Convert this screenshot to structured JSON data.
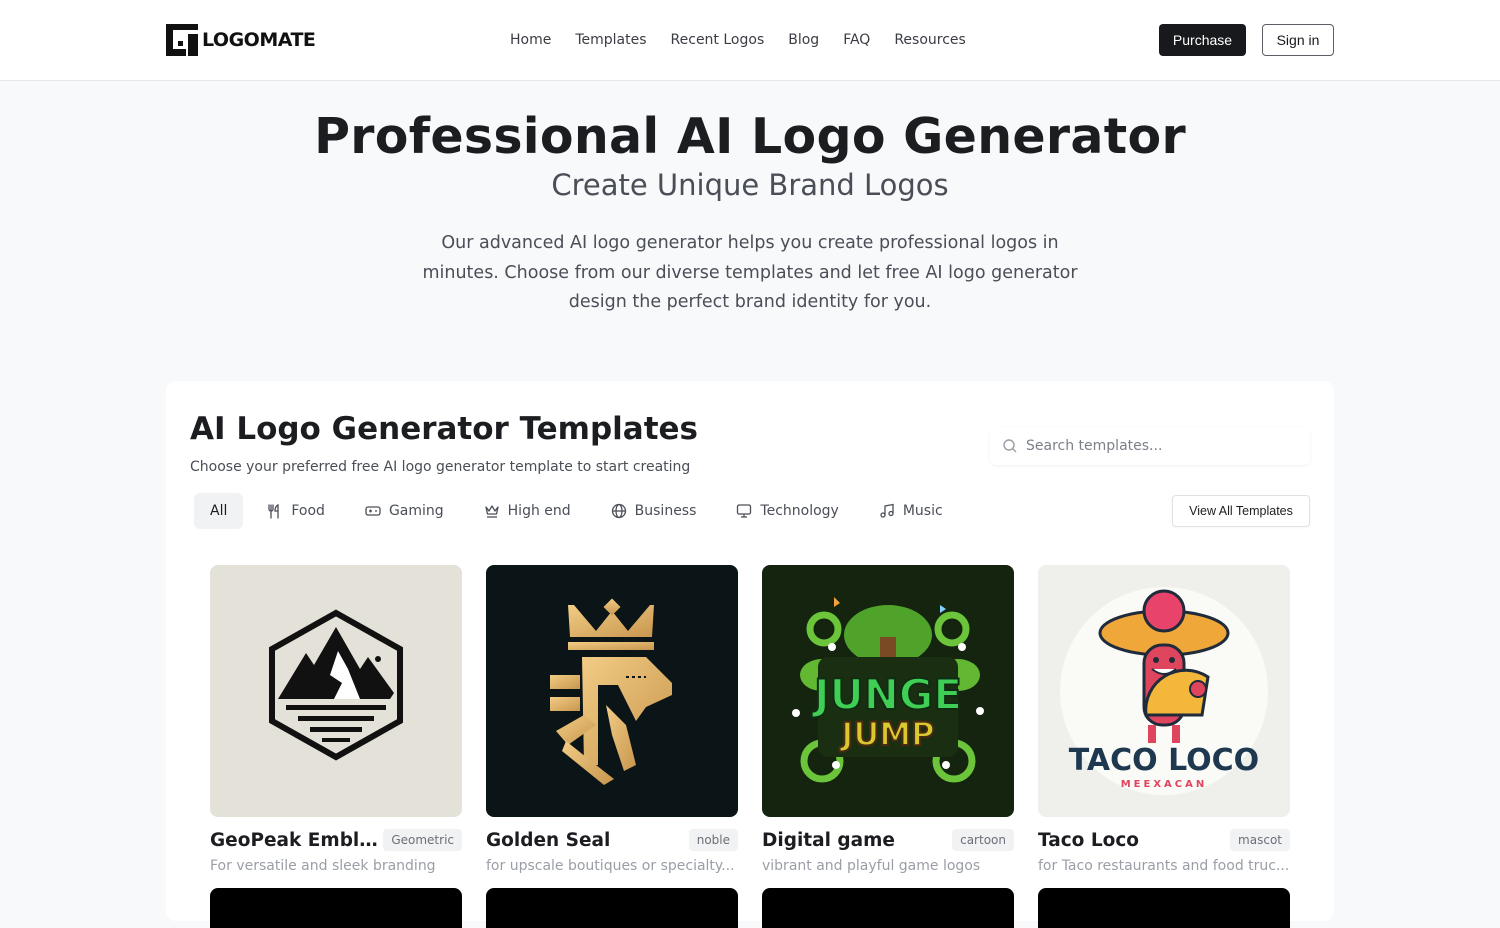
{
  "header": {
    "logo_text": "LOGOMATE",
    "nav": [
      "Home",
      "Templates",
      "Recent Logos",
      "Blog",
      "FAQ",
      "Resources"
    ],
    "purchase_label": "Purchase",
    "signin_label": "Sign in"
  },
  "hero": {
    "title": "Professional AI Logo Generator",
    "subtitle": "Create Unique Brand Logos",
    "description": "Our advanced AI logo generator helps you create professional logos in minutes. Choose from our diverse templates and let free AI logo generator design the perfect brand identity for you."
  },
  "templates": {
    "title": "AI Logo Generator Templates",
    "subtitle": "Choose your preferred free AI logo generator template to start creating",
    "search_placeholder": "Search templates...",
    "view_all_label": "View All Templates",
    "filters": [
      {
        "label": "All",
        "icon": "none",
        "active": true
      },
      {
        "label": "Food",
        "icon": "utensils-icon"
      },
      {
        "label": "Gaming",
        "icon": "gamepad-icon"
      },
      {
        "label": "High end",
        "icon": "crown-icon"
      },
      {
        "label": "Business",
        "icon": "globe-icon"
      },
      {
        "label": "Technology",
        "icon": "monitor-icon"
      },
      {
        "label": "Music",
        "icon": "music-icon"
      }
    ],
    "cards": [
      {
        "title": "GeoPeak Embl...",
        "tag": "Geometric",
        "desc": "For versatile and sleek branding",
        "image": "mountain-hexagon-emblem"
      },
      {
        "title": "Golden Seal",
        "tag": "noble",
        "desc": "for upscale boutiques or specialty...",
        "image": "golden-lion-crown"
      },
      {
        "title": "Digital game",
        "tag": "cartoon",
        "desc": "vibrant and playful game logos",
        "image": "jungle-jump-game-logo",
        "image_text": [
          "JUNGE",
          "JUMP"
        ]
      },
      {
        "title": "Taco Loco",
        "tag": "mascot",
        "desc": "for Taco restaurants and food truc...",
        "image": "taco-mascot-sombrero",
        "image_text": [
          "TACO LOCO",
          "MEEXACAN"
        ]
      }
    ]
  },
  "colors": {
    "primary": "#18191c",
    "background": "#f8f9fb",
    "muted_text": "#9a9ea6"
  }
}
